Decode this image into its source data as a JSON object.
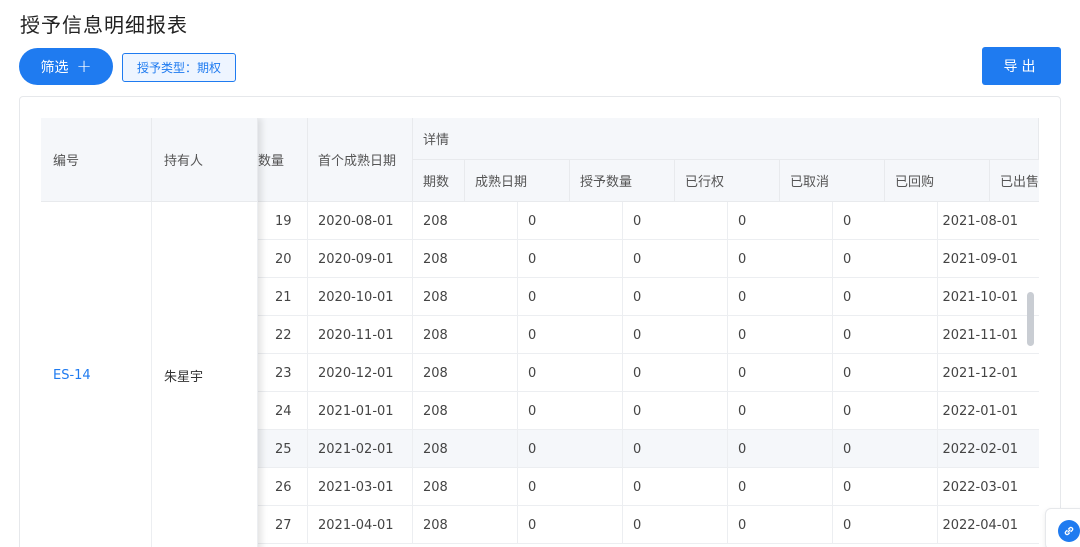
{
  "page_title": "授予信息明细报表",
  "toolbar": {
    "filter_label": "筛选",
    "filter_plus": "+",
    "filter_tag": "授予类型：期权",
    "export_label": "导出"
  },
  "table": {
    "headers": {
      "id": "编号",
      "holder": "持有人",
      "qty_partial": "数量",
      "first_vest_date": "首个成熟日期",
      "details": "详情",
      "period": "期数",
      "vest_date": "成熟日期",
      "grant_qty": "授予数量",
      "exercised": "已行权",
      "cancelled": "已取消",
      "repurchased": "已回购",
      "sold": "已出售"
    },
    "group": {
      "id": "ES-14",
      "holder": "朱星宇"
    },
    "rows": [
      {
        "n": "19",
        "first": "2020-08-01",
        "qty": "208",
        "a": "0",
        "b": "0",
        "c": "0",
        "d": "0",
        "date": "2021-08-01"
      },
      {
        "n": "20",
        "first": "2020-09-01",
        "qty": "208",
        "a": "0",
        "b": "0",
        "c": "0",
        "d": "0",
        "date": "2021-09-01"
      },
      {
        "n": "21",
        "first": "2020-10-01",
        "qty": "208",
        "a": "0",
        "b": "0",
        "c": "0",
        "d": "0",
        "date": "2021-10-01"
      },
      {
        "n": "22",
        "first": "2020-11-01",
        "qty": "208",
        "a": "0",
        "b": "0",
        "c": "0",
        "d": "0",
        "date": "2021-11-01"
      },
      {
        "n": "23",
        "first": "2020-12-01",
        "qty": "208",
        "a": "0",
        "b": "0",
        "c": "0",
        "d": "0",
        "date": "2021-12-01"
      },
      {
        "n": "24",
        "first": "2021-01-01",
        "qty": "208",
        "a": "0",
        "b": "0",
        "c": "0",
        "d": "0",
        "date": "2022-01-01"
      },
      {
        "n": "25",
        "first": "2021-02-01",
        "qty": "208",
        "a": "0",
        "b": "0",
        "c": "0",
        "d": "0",
        "date": "2022-02-01"
      },
      {
        "n": "26",
        "first": "2021-03-01",
        "qty": "208",
        "a": "0",
        "b": "0",
        "c": "0",
        "d": "0",
        "date": "2022-03-01"
      },
      {
        "n": "27",
        "first": "2021-04-01",
        "qty": "208",
        "a": "0",
        "b": "0",
        "c": "0",
        "d": "0",
        "date": "2022-04-01"
      }
    ]
  },
  "float_icon": "link-icon"
}
